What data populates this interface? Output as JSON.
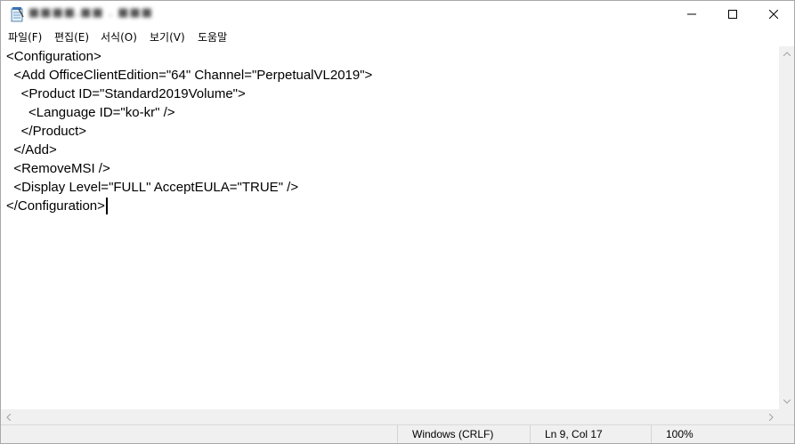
{
  "window": {
    "title": "■■■■.■■ . ■■■",
    "controls": {
      "minimize": "─",
      "maximize": "☐",
      "close": "✕"
    }
  },
  "menu": {
    "items": [
      "파일(F)",
      "편집(E)",
      "서식(O)",
      "보기(V)",
      "도움말"
    ]
  },
  "editor": {
    "lines": [
      "<Configuration>",
      "  <Add OfficeClientEdition=\"64\" Channel=\"PerpetualVL2019\">",
      "    <Product ID=\"Standard2019Volume\">",
      "      <Language ID=\"ko-kr\" />",
      "    </Product>",
      "  </Add>",
      "  <RemoveMSI />",
      "  <Display Level=\"FULL\" AcceptEULA=\"TRUE\" />",
      "</Configuration>"
    ]
  },
  "status": {
    "line_ending": "Windows (CRLF)",
    "position": "Ln 9, Col 17",
    "zoom": "100%"
  },
  "colors": {
    "chrome": "#f0f0f0",
    "text": "#000000",
    "border": "#a8a8a8"
  },
  "icons": {
    "app": "notepad-icon",
    "scroll_up": "chevron-up-icon",
    "scroll_down": "chevron-down-icon",
    "scroll_left": "chevron-left-icon",
    "scroll_right": "chevron-right-icon"
  }
}
